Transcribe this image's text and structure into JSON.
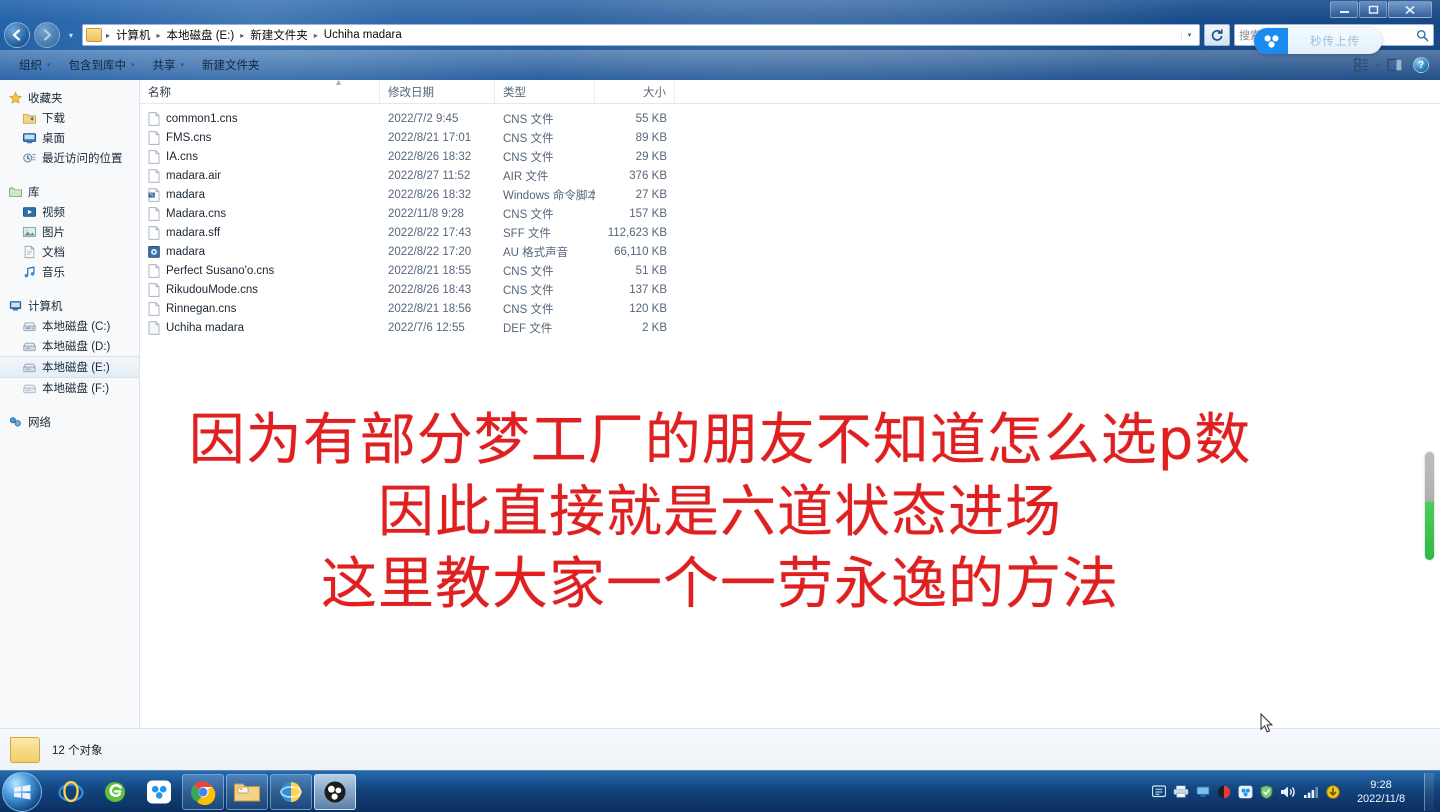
{
  "window": {
    "controls": {
      "minimize": "—",
      "maximize": "❐",
      "close": "✕"
    }
  },
  "nav": {
    "back_icon": "back-arrow",
    "forward_icon": "forward-arrow",
    "recent_dropdown": "▾",
    "breadcrumbs": [
      "计算机",
      "本地磁盘 (E:)",
      "新建文件夹",
      "Uchiha madara"
    ],
    "separator": "▸",
    "dropdown_caret": "▾",
    "refresh_label": "↻",
    "search_placeholder": "搜索 Uchiha madara",
    "search_value": "",
    "search_icon": "🔍"
  },
  "baidu_pill": {
    "label": "秒传上传",
    "badge_icon": "baidu-netdisk-icon",
    "accent": "#1a8cf0"
  },
  "toolbar": {
    "items": [
      {
        "label": "组织",
        "caret": "▾"
      },
      {
        "label": "包含到库中",
        "caret": "▾"
      },
      {
        "label": "共享",
        "caret": "▾"
      },
      {
        "label": "新建文件夹",
        "caret": ""
      }
    ],
    "view_caret": "▾",
    "view_icon": "view-layout-icon",
    "preview_icon": "preview-pane-icon",
    "help_label": "?"
  },
  "sidebar": {
    "groups": [
      {
        "root": {
          "label": "收藏夹",
          "icon": "star-icon"
        },
        "children": [
          {
            "label": "下载",
            "icon": "downloads-icon",
            "selected": false
          },
          {
            "label": "桌面",
            "icon": "desktop-icon",
            "selected": false
          },
          {
            "label": "最近访问的位置",
            "icon": "recent-places-icon",
            "selected": false
          }
        ]
      },
      {
        "root": {
          "label": "库",
          "icon": "library-icon"
        },
        "children": [
          {
            "label": "视频",
            "icon": "video-icon",
            "selected": false
          },
          {
            "label": "图片",
            "icon": "picture-icon",
            "selected": false
          },
          {
            "label": "文档",
            "icon": "document-icon",
            "selected": false
          },
          {
            "label": "音乐",
            "icon": "music-icon",
            "selected": false
          }
        ]
      },
      {
        "root": {
          "label": "计算机",
          "icon": "computer-icon"
        },
        "children": [
          {
            "label": "本地磁盘 (C:)",
            "icon": "system-drive-icon",
            "selected": false
          },
          {
            "label": "本地磁盘 (D:)",
            "icon": "drive-icon",
            "selected": false
          },
          {
            "label": "本地磁盘 (E:)",
            "icon": "drive-icon",
            "selected": true
          },
          {
            "label": "本地磁盘 (F:)",
            "icon": "drive-icon",
            "selected": false
          }
        ]
      },
      {
        "root": {
          "label": "网络",
          "icon": "network-icon"
        },
        "children": []
      }
    ]
  },
  "filelist": {
    "columns": [
      "名称",
      "修改日期",
      "类型",
      "大小"
    ],
    "sort_marker": "▲",
    "rows": [
      {
        "name": "common1.cns",
        "date": "2022/7/2 9:45",
        "type": "CNS 文件",
        "size": "55 KB",
        "icon": "blank-file-icon"
      },
      {
        "name": "FMS.cns",
        "date": "2022/8/21 17:01",
        "type": "CNS 文件",
        "size": "89 KB",
        "icon": "blank-file-icon"
      },
      {
        "name": "IA.cns",
        "date": "2022/8/26 18:32",
        "type": "CNS 文件",
        "size": "29 KB",
        "icon": "blank-file-icon"
      },
      {
        "name": "madara.air",
        "date": "2022/8/27 11:52",
        "type": "AIR 文件",
        "size": "376 KB",
        "icon": "blank-file-icon"
      },
      {
        "name": "madara",
        "date": "2022/8/26 18:32",
        "type": "Windows 命令脚本",
        "size": "27 KB",
        "icon": "script-file-icon"
      },
      {
        "name": "Madara.cns",
        "date": "2022/11/8 9:28",
        "type": "CNS 文件",
        "size": "157 KB",
        "icon": "blank-file-icon"
      },
      {
        "name": "madara.sff",
        "date": "2022/8/22 17:43",
        "type": "SFF 文件",
        "size": "112,623 KB",
        "icon": "blank-file-icon"
      },
      {
        "name": "madara",
        "date": "2022/8/22 17:20",
        "type": "AU 格式声音",
        "size": "66,110 KB",
        "icon": "audio-file-icon"
      },
      {
        "name": "Perfect Susano'o.cns",
        "date": "2022/8/21 18:55",
        "type": "CNS 文件",
        "size": "51 KB",
        "icon": "blank-file-icon"
      },
      {
        "name": "RikudouMode.cns",
        "date": "2022/8/26 18:43",
        "type": "CNS 文件",
        "size": "137 KB",
        "icon": "blank-file-icon"
      },
      {
        "name": "Rinnegan.cns",
        "date": "2022/8/21 18:56",
        "type": "CNS 文件",
        "size": "120 KB",
        "icon": "blank-file-icon"
      },
      {
        "name": "Uchiha madara",
        "date": "2022/7/6 12:55",
        "type": "DEF 文件",
        "size": "2 KB",
        "icon": "blank-file-icon"
      }
    ]
  },
  "statusbar": {
    "count_text": "12 个对象",
    "folder_icon": "folder-icon"
  },
  "subtitles": {
    "color": "#e02020",
    "lines": [
      "因为有部分梦工厂的朋友不知道怎么选p数",
      "因此直接就是六道状态进场",
      "这里教大家一个一劳永逸的方法"
    ]
  },
  "taskbar": {
    "start_label": "开始",
    "apps": [
      {
        "name": "internet-explorer",
        "state": "pinned"
      },
      {
        "name": "360-browser",
        "state": "pinned"
      },
      {
        "name": "baidu-netdisk",
        "state": "pinned"
      },
      {
        "name": "google-chrome",
        "state": "open"
      },
      {
        "name": "windows-explorer",
        "state": "open"
      },
      {
        "name": "ie-window",
        "state": "open"
      },
      {
        "name": "obs-studio",
        "state": "active"
      }
    ],
    "clock_time": "9:28",
    "clock_date": "2022/11/8",
    "tray_icons": [
      "input-method-icon",
      "printer-icon",
      "network-share-icon",
      "antivirus-icon",
      "baidu-tray-icon",
      "shield-icon",
      "volume-icon",
      "network-signal-icon",
      "update-icon"
    ]
  }
}
